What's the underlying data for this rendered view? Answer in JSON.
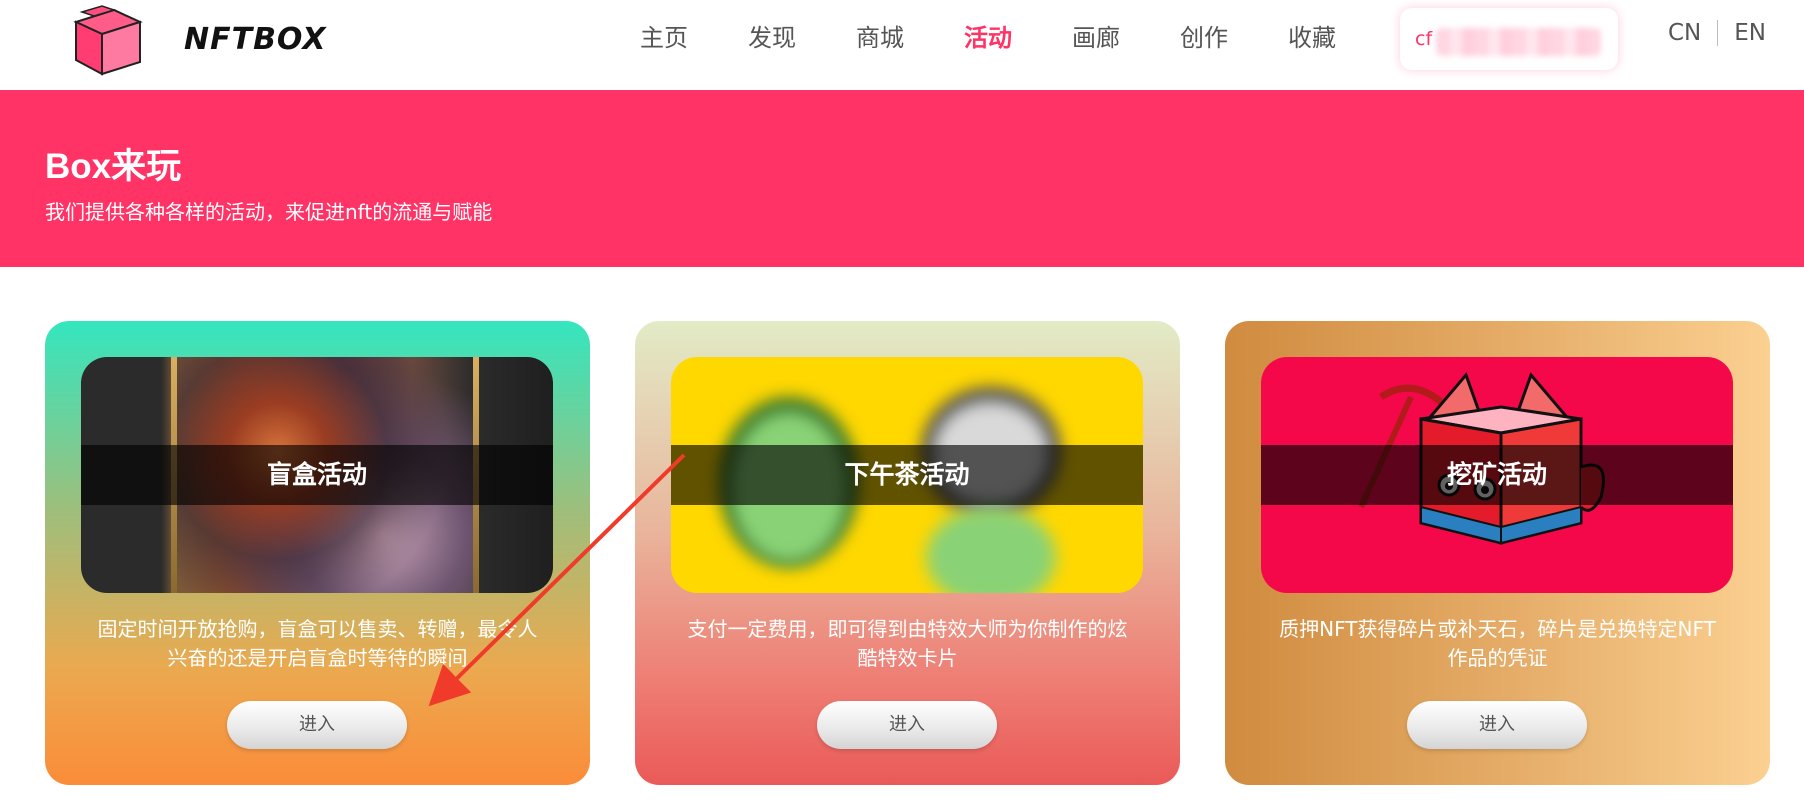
{
  "header": {
    "logo_text": "NFTBOX",
    "nav": [
      {
        "label": "主页",
        "active": false
      },
      {
        "label": "发现",
        "active": false
      },
      {
        "label": "商城",
        "active": false
      },
      {
        "label": "活动",
        "active": true
      },
      {
        "label": "画廊",
        "active": false
      },
      {
        "label": "创作",
        "active": false
      },
      {
        "label": "收藏",
        "active": false
      }
    ],
    "wallet_prefix": "cf",
    "lang_cn": "CN",
    "lang_en": "EN"
  },
  "banner": {
    "title": "Box来玩",
    "subtitle": "我们提供各种各样的活动，来促进nft的流通与赋能"
  },
  "cards": [
    {
      "title": "盲盒活动",
      "desc_line1": "固定时间开放抢购，盲盒可以售卖、转赠，最令人",
      "desc_line2": "兴奋的还是开启盲盒时等待的瞬间",
      "button": "进入"
    },
    {
      "title": "下午茶活动",
      "desc_line1": "支付一定费用，即可得到由特效大师为你制作的炫",
      "desc_line2": "酷特效卡片",
      "button": "进入"
    },
    {
      "title": "挖矿活动",
      "desc_line1": "质押NFT获得碎片或补天石，碎片是兑换特定NFT",
      "desc_line2": "作品的凭证",
      "button": "进入"
    }
  ],
  "colors": {
    "brand": "#ff3366",
    "annotation_arrow": "#f03a2a"
  }
}
